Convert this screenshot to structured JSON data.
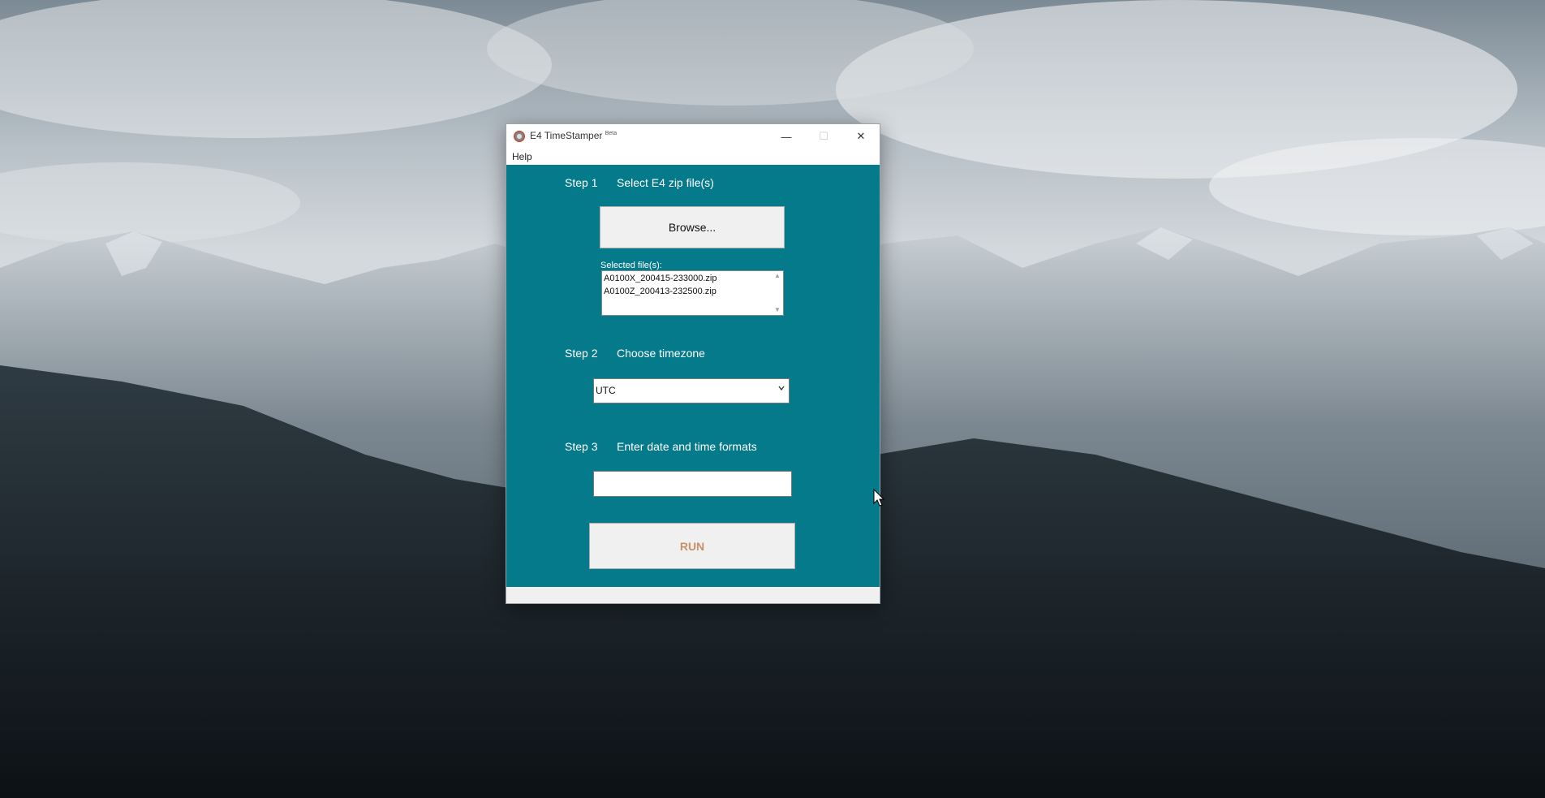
{
  "window": {
    "title": "E4 TimeStamper",
    "title_badge": "Beta",
    "controls": {
      "minimize": "—",
      "maximize": "☐",
      "close": "✕"
    }
  },
  "menu": {
    "help": "Help"
  },
  "step1": {
    "label": "Step 1",
    "description": "Select E4 zip file(s)",
    "browse_button": "Browse...",
    "files_label": "Selected file(s):",
    "files": [
      "A0100X_200415-233000.zip",
      "A0100Z_200413-232500.zip"
    ]
  },
  "step2": {
    "label": "Step 2",
    "description": "Choose timezone",
    "timezone_value": "UTC"
  },
  "step3": {
    "label": "Step 3",
    "description": "Enter date and time formats",
    "format_value": ""
  },
  "run_button": "RUN",
  "colors": {
    "client_background": "#047a8a",
    "run_text": "#c8906a"
  },
  "icons": {
    "app": "app-icon",
    "dropdown": "chevron-down-icon",
    "cursor": "mouse-cursor-icon"
  }
}
